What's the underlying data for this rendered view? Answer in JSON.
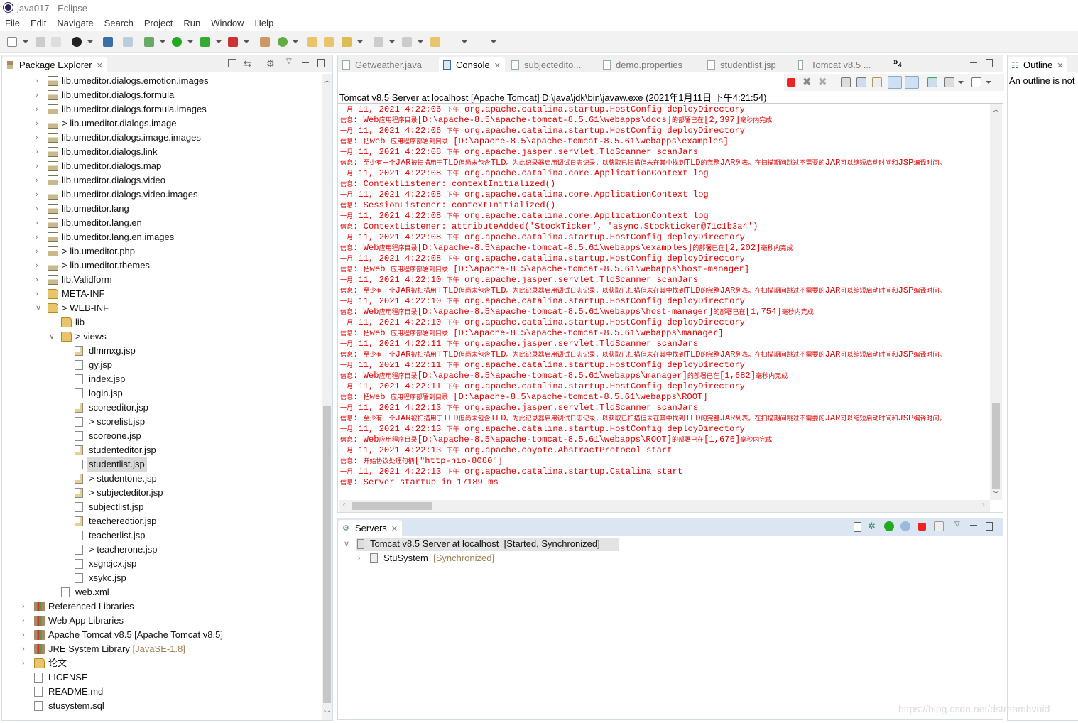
{
  "window": {
    "title": "java017 - Eclipse"
  },
  "menu": [
    "File",
    "Edit",
    "Navigate",
    "Search",
    "Project",
    "Run",
    "Window",
    "Help"
  ],
  "package_explorer": {
    "title": "Package Explorer",
    "items": [
      {
        "level": 1,
        "arrow": "collapsed",
        "icon": "package",
        "label": "lib.umeditor.dialogs.emotion.images"
      },
      {
        "level": 1,
        "arrow": "collapsed",
        "icon": "package",
        "label": "lib.umeditor.dialogs.formula"
      },
      {
        "level": 1,
        "arrow": "collapsed",
        "icon": "package",
        "label": "lib.umeditor.dialogs.formula.images"
      },
      {
        "level": 1,
        "arrow": "collapsed",
        "icon": "package",
        "label": "> lib.umeditor.dialogs.image"
      },
      {
        "level": 1,
        "arrow": "collapsed",
        "icon": "package",
        "label": "lib.umeditor.dialogs.image.images"
      },
      {
        "level": 1,
        "arrow": "collapsed",
        "icon": "package",
        "label": "lib.umeditor.dialogs.link"
      },
      {
        "level": 1,
        "arrow": "collapsed",
        "icon": "package",
        "label": "lib.umeditor.dialogs.map"
      },
      {
        "level": 1,
        "arrow": "collapsed",
        "icon": "package",
        "label": "lib.umeditor.dialogs.video"
      },
      {
        "level": 1,
        "arrow": "collapsed",
        "icon": "package",
        "label": "lib.umeditor.dialogs.video.images"
      },
      {
        "level": 1,
        "arrow": "collapsed",
        "icon": "package",
        "label": "lib.umeditor.lang"
      },
      {
        "level": 1,
        "arrow": "collapsed",
        "icon": "package",
        "label": "lib.umeditor.lang.en"
      },
      {
        "level": 1,
        "arrow": "collapsed",
        "icon": "package",
        "label": "lib.umeditor.lang.en.images"
      },
      {
        "level": 1,
        "arrow": "collapsed",
        "icon": "package",
        "label": "> lib.umeditor.php"
      },
      {
        "level": 1,
        "arrow": "collapsed",
        "icon": "package",
        "label": "> lib.umeditor.themes"
      },
      {
        "level": 1,
        "arrow": "collapsed",
        "icon": "package",
        "label": "lib.Validform"
      },
      {
        "level": 1,
        "arrow": "collapsed",
        "icon": "folder",
        "label": "META-INF"
      },
      {
        "level": 1,
        "arrow": "expanded",
        "icon": "folder",
        "label": "> WEB-INF"
      },
      {
        "level": 2,
        "arrow": "none",
        "icon": "folder",
        "label": "lib"
      },
      {
        "level": 2,
        "arrow": "expanded",
        "icon": "folder",
        "label": "> views"
      },
      {
        "level": 3,
        "arrow": "none",
        "icon": "jsp",
        "label": "dlmmxg.jsp"
      },
      {
        "level": 3,
        "arrow": "none",
        "icon": "file",
        "label": "gy.jsp"
      },
      {
        "level": 3,
        "arrow": "none",
        "icon": "file",
        "label": "index.jsp"
      },
      {
        "level": 3,
        "arrow": "none",
        "icon": "file",
        "label": "login.jsp"
      },
      {
        "level": 3,
        "arrow": "none",
        "icon": "jsp",
        "label": "scoreeditor.jsp"
      },
      {
        "level": 3,
        "arrow": "none",
        "icon": "file",
        "label": "> scorelist.jsp"
      },
      {
        "level": 3,
        "arrow": "none",
        "icon": "file",
        "label": "scoreone.jsp"
      },
      {
        "level": 3,
        "arrow": "none",
        "icon": "jsp",
        "label": "studenteditor.jsp"
      },
      {
        "level": 3,
        "arrow": "none",
        "icon": "file",
        "label": "studentlist.jsp",
        "selected": true
      },
      {
        "level": 3,
        "arrow": "none",
        "icon": "jsp",
        "label": "> studentone.jsp"
      },
      {
        "level": 3,
        "arrow": "none",
        "icon": "jsp",
        "label": "> subjecteditor.jsp"
      },
      {
        "level": 3,
        "arrow": "none",
        "icon": "file",
        "label": "subjectlist.jsp"
      },
      {
        "level": 3,
        "arrow": "none",
        "icon": "jsp",
        "label": "teacheredtior.jsp"
      },
      {
        "level": 3,
        "arrow": "none",
        "icon": "file",
        "label": "teacherlist.jsp"
      },
      {
        "level": 3,
        "arrow": "none",
        "icon": "file",
        "label": "> teacherone.jsp"
      },
      {
        "level": 3,
        "arrow": "none",
        "icon": "file",
        "label": "xsgrcjcx.jsp"
      },
      {
        "level": 3,
        "arrow": "none",
        "icon": "file",
        "label": "xsykc.jsp"
      },
      {
        "level": 2,
        "arrow": "none",
        "icon": "file",
        "label": "web.xml"
      },
      {
        "level": 0,
        "arrow": "collapsed",
        "icon": "library",
        "label": "Referenced Libraries"
      },
      {
        "level": 0,
        "arrow": "collapsed",
        "icon": "library",
        "label": "Web App Libraries"
      },
      {
        "level": 0,
        "arrow": "collapsed",
        "icon": "library",
        "label": "Apache Tomcat v8.5 [Apache Tomcat v8.5]"
      },
      {
        "level": 0,
        "arrow": "collapsed",
        "icon": "library",
        "label": "JRE System Library",
        "suffix": "[JavaSE-1.8]"
      },
      {
        "level": 0,
        "arrow": "collapsed",
        "icon": "folder",
        "label": "论文"
      },
      {
        "level": 0,
        "arrow": "none",
        "icon": "file",
        "label": "LICENSE"
      },
      {
        "level": 0,
        "arrow": "none",
        "icon": "file",
        "label": "README.md"
      },
      {
        "level": 0,
        "arrow": "none",
        "icon": "file",
        "label": "stusystem.sql"
      }
    ]
  },
  "editor_tabs": [
    {
      "label": "Getweather.java"
    },
    {
      "label": "Console",
      "active": true
    },
    {
      "label": "subjectedito..."
    },
    {
      "label": "demo.properties"
    },
    {
      "label": "studentlist.jsp"
    },
    {
      "label": "Tomcat v8.5 ..."
    }
  ],
  "overflow_tabs": {
    "label": "»",
    "count": "4"
  },
  "console": {
    "header": "Tomcat v8.5 Server at localhost [Apache Tomcat] D:\\java\\jdk\\bin\\javaw.exe (2021年1月11日 下午4:21:54)",
    "lines": [
      "一月 11, 2021 4:22:06 下午 org.apache.catalina.startup.HostConfig deployDirectory",
      "信息: Web应用程序目录[D:\\apache-8.5\\apache-tomcat-8.5.61\\webapps\\docs]的部署已在[2,397]毫秒内完成",
      "一月 11, 2021 4:22:06 下午 org.apache.catalina.startup.HostConfig deployDirectory",
      "信息: 把web 应用程序部署到目录 [D:\\apache-8.5\\apache-tomcat-8.5.61\\webapps\\examples]",
      "一月 11, 2021 4:22:08 下午 org.apache.jasper.servlet.TldScanner scanJars",
      "信息: 至少有一个JAR被扫描用于TLD但尚未包含TLD。为此记录器启用调试日志记录，以获取已扫描但未在其中找到TLD的完整JAR列表。在扫描期间跳过不需要的JAR可以缩短启动时间和JSP编译时间。",
      "一月 11, 2021 4:22:08 下午 org.apache.catalina.core.ApplicationContext log",
      "信息: ContextListener: contextInitialized()",
      "一月 11, 2021 4:22:08 下午 org.apache.catalina.core.ApplicationContext log",
      "信息: SessionListener: contextInitialized()",
      "一月 11, 2021 4:22:08 下午 org.apache.catalina.core.ApplicationContext log",
      "信息: ContextListener: attributeAdded('StockTicker', 'async.Stockticker@71c1b3a4')",
      "一月 11, 2021 4:22:08 下午 org.apache.catalina.startup.HostConfig deployDirectory",
      "信息: Web应用程序目录[D:\\apache-8.5\\apache-tomcat-8.5.61\\webapps\\examples]的部署已在[2,202]毫秒内完成",
      "一月 11, 2021 4:22:08 下午 org.apache.catalina.startup.HostConfig deployDirectory",
      "信息: 把web 应用程序部署到目录 [D:\\apache-8.5\\apache-tomcat-8.5.61\\webapps\\host-manager]",
      "一月 11, 2021 4:22:10 下午 org.apache.jasper.servlet.TldScanner scanJars",
      "信息: 至少有一个JAR被扫描用于TLD但尚未包含TLD。为此记录器启用调试日志记录，以获取已扫描但未在其中找到TLD的完整JAR列表。在扫描期间跳过不需要的JAR可以缩短启动时间和JSP编译时间。",
      "一月 11, 2021 4:22:10 下午 org.apache.catalina.startup.HostConfig deployDirectory",
      "信息: Web应用程序目录[D:\\apache-8.5\\apache-tomcat-8.5.61\\webapps\\host-manager]的部署已在[1,754]毫秒内完成",
      "一月 11, 2021 4:22:10 下午 org.apache.catalina.startup.HostConfig deployDirectory",
      "信息: 把web 应用程序部署到目录 [D:\\apache-8.5\\apache-tomcat-8.5.61\\webapps\\manager]",
      "一月 11, 2021 4:22:11 下午 org.apache.jasper.servlet.TldScanner scanJars",
      "信息: 至少有一个JAR被扫描用于TLD但尚未包含TLD。为此记录器启用调试日志记录，以获取已扫描但未在其中找到TLD的完整JAR列表。在扫描期间跳过不需要的JAR可以缩短启动时间和JSP编译时间。",
      "一月 11, 2021 4:22:11 下午 org.apache.catalina.startup.HostConfig deployDirectory",
      "信息: Web应用程序目录[D:\\apache-8.5\\apache-tomcat-8.5.61\\webapps\\manager]的部署已在[1,682]毫秒内完成",
      "一月 11, 2021 4:22:11 下午 org.apache.catalina.startup.HostConfig deployDirectory",
      "信息: 把web 应用程序部署到目录 [D:\\apache-8.5\\apache-tomcat-8.5.61\\webapps\\ROOT]",
      "一月 11, 2021 4:22:13 下午 org.apache.jasper.servlet.TldScanner scanJars",
      "信息: 至少有一个JAR被扫描用于TLD但尚未包含TLD。为此记录器启用调试日志记录，以获取已扫描但未在其中找到TLD的完整JAR列表。在扫描期间跳过不需要的JAR可以缩短启动时间和JSP编译时间。",
      "一月 11, 2021 4:22:13 下午 org.apache.catalina.startup.HostConfig deployDirectory",
      "信息: Web应用程序目录[D:\\apache-8.5\\apache-tomcat-8.5.61\\webapps\\ROOT]的部署已在[1,676]毫秒内完成",
      "一月 11, 2021 4:22:13 下午 org.apache.coyote.AbstractProtocol start",
      "信息: 开始协议处理句柄[\"http-nio-8080\"]",
      "一月 11, 2021 4:22:13 下午 org.apache.catalina.startup.Catalina start",
      "信息: Server startup in 17189 ms"
    ],
    "text_color": "#e00000"
  },
  "servers": {
    "title": "Servers",
    "server": {
      "label": "Tomcat v8.5 Server at localhost",
      "status": "[Started, Synchronized]"
    },
    "module": {
      "label": "StuSystem",
      "status": "[Synchronized]"
    }
  },
  "outline": {
    "title": "Outline",
    "message": "An outline is not"
  },
  "watermark": "https://blog.csdn.net/dstreamhvoid"
}
